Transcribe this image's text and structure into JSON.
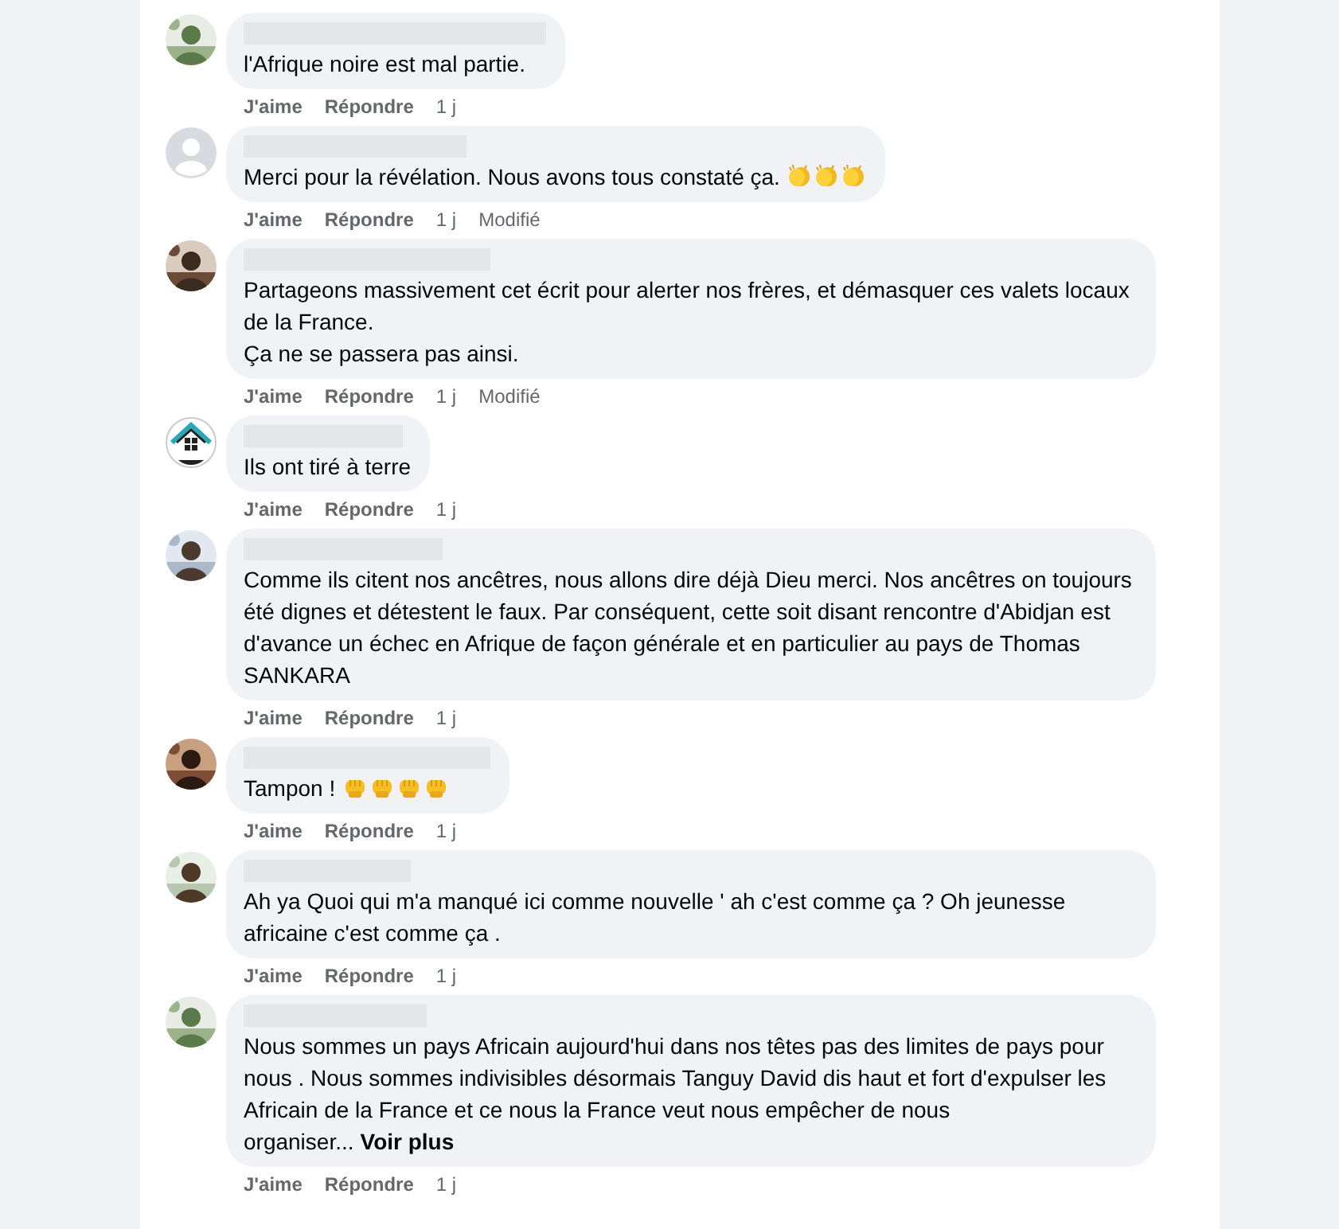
{
  "comments": [
    {
      "avatar": {
        "kind": "picture"
      },
      "text": "l'Afrique noire est mal partie.",
      "actions": [
        "J'aime",
        "Répondre"
      ],
      "time": "1 j"
    },
    {
      "avatar": {
        "kind": "default"
      },
      "text": "Merci pour la révélation. Nous avons tous constaté ça.",
      "emojis": [
        {
          "kind": "clap"
        },
        {
          "kind": "clap"
        },
        {
          "kind": "clap"
        }
      ],
      "actions": [
        "J'aime",
        "Répondre"
      ],
      "time": "1 j",
      "edited": "Modifié"
    },
    {
      "avatar": {
        "kind": "picture"
      },
      "text": "Partageons massivement cet écrit pour alerter nos frères, et démasquer ces valets locaux de la France.\nÇa ne se passera pas ainsi.",
      "actions": [
        "J'aime",
        "Répondre"
      ],
      "time": "1 j",
      "edited": "Modifié"
    },
    {
      "avatar": {
        "kind": "house"
      },
      "text": "Ils ont tiré à terre",
      "actions": [
        "J'aime",
        "Répondre"
      ],
      "time": "1 j"
    },
    {
      "avatar": {
        "kind": "picture"
      },
      "text": "Comme ils citent nos ancêtres, nous allons dire déjà Dieu merci. Nos ancêtres on toujours été dignes et détestent le faux. Par conséquent, cette soit disant rencontre d'Abidjan est d'avance un échec en Afrique de façon générale et en particulier au pays de Thomas SANKARA",
      "actions": [
        "J'aime",
        "Répondre"
      ],
      "time": "1 j"
    },
    {
      "avatar": {
        "kind": "picture"
      },
      "text": "Tampon !",
      "emojis": [
        {
          "kind": "fist"
        },
        {
          "kind": "fist"
        },
        {
          "kind": "fist"
        },
        {
          "kind": "fist"
        }
      ],
      "actions": [
        "J'aime",
        "Répondre"
      ],
      "time": "1 j"
    },
    {
      "avatar": {
        "kind": "picture"
      },
      "text": "Ah ya Quoi qui m'a manqué ici comme nouvelle ' ah c'est comme ça ? Oh jeunesse africaine c'est comme ça .",
      "actions": [
        "J'aime",
        "Répondre"
      ],
      "time": "1 j"
    },
    {
      "avatar": {
        "kind": "picture"
      },
      "text": "Nous sommes un pays Africain aujourd'hui dans nos têtes pas des limites de pays pour nous . Nous sommes indivisibles désormais Tanguy David dis haut et fort d'expulser les Africain de la France et ce nous la France veut nous empêcher de nous organiser...",
      "see_more": "Voir plus",
      "actions": [
        "J'aime",
        "Répondre"
      ],
      "time": "1 j"
    }
  ]
}
